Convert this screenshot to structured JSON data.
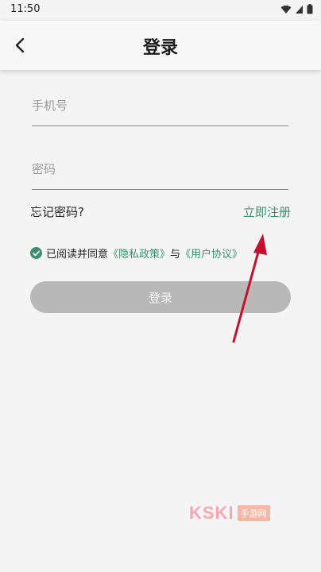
{
  "status": {
    "time": "11:50",
    "icons": [
      "wifi-icon",
      "signal-icon",
      "battery-icon"
    ]
  },
  "header": {
    "title": "登录",
    "back_icon": "back-arrow-icon"
  },
  "form": {
    "phone_placeholder": "手机号",
    "password_placeholder": "密码",
    "forgot_label": "忘记密码?",
    "register_label": "立即注册",
    "agree_prefix": "已阅读并同意",
    "privacy_link": "《隐私政策》",
    "conjunction": "与",
    "terms_link": "《用户协议》",
    "agreed": true,
    "login_label": "登录"
  },
  "watermark": {
    "text": "KSKI",
    "box": "手游网"
  },
  "colors": {
    "accent": "#3c8f6e",
    "button_disabled": "#b8b8b8",
    "annotation_arrow": "#c8102e"
  }
}
